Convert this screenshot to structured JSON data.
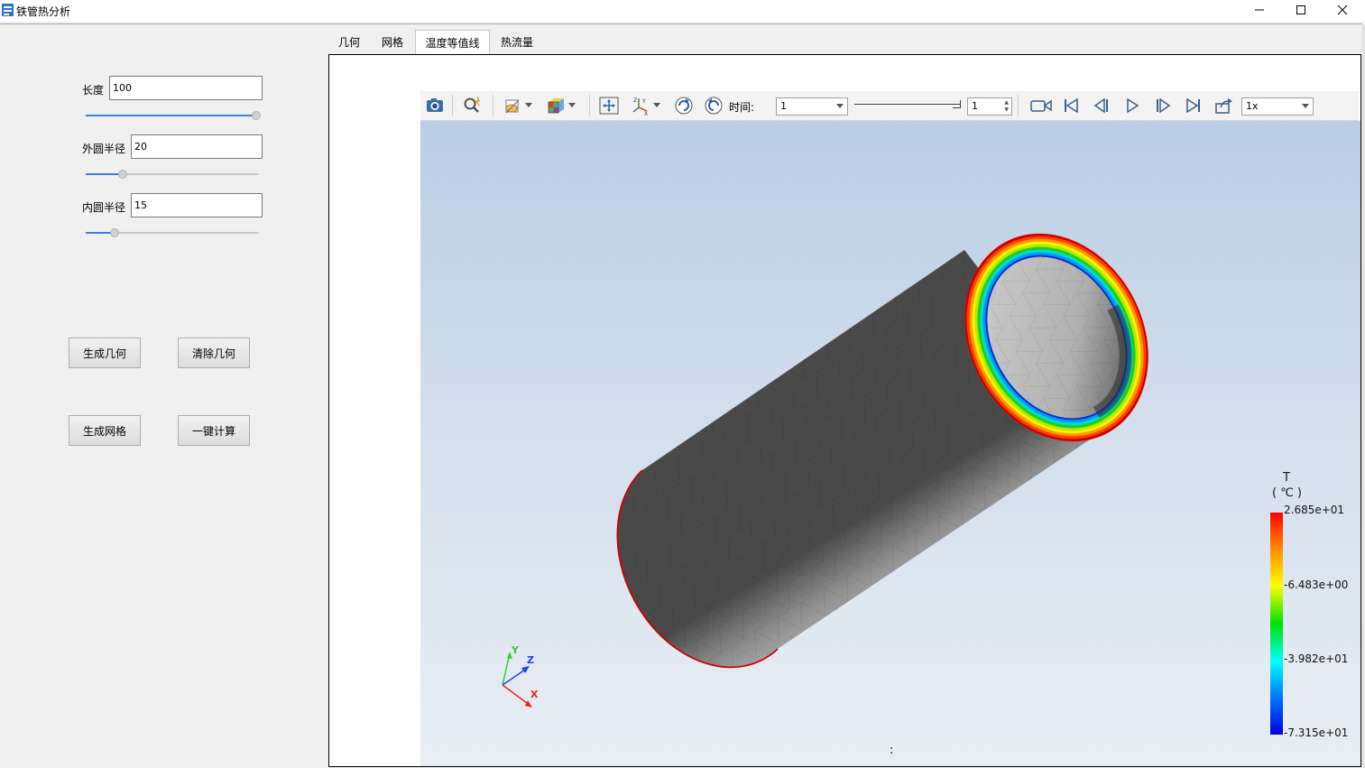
{
  "window": {
    "title": "铁管热分析",
    "buttons": {
      "minimize": "—",
      "maximize": "☐",
      "close": "✕"
    }
  },
  "params": {
    "length": {
      "label": "长度",
      "value": "100",
      "slider": 1.0
    },
    "outer_radius": {
      "label": "外圆半径",
      "value": "20",
      "slider": 0.2
    },
    "inner_radius": {
      "label": "内圆半径",
      "value": "15",
      "slider": 0.15
    }
  },
  "buttons": {
    "gen_geometry": "生成几何",
    "clear_geometry": "清除几何",
    "gen_mesh": "生成网格",
    "compute": "一键计算"
  },
  "tabs": [
    {
      "label": "几何",
      "active": false
    },
    {
      "label": "网格",
      "active": false
    },
    {
      "label": "温度等值线",
      "active": true
    },
    {
      "label": "热流量",
      "active": false
    }
  ],
  "toolbar": {
    "time_label": "时间:",
    "time_value": "1",
    "step_value": "1",
    "speed_value": "1x"
  },
  "icons": {
    "screenshot": "camera-icon",
    "zoom": "zoom-icon",
    "display": "display-mode-icon",
    "colormap": "colormap-cube-icon",
    "fit": "fit-view-icon",
    "axes": "axes-icon",
    "rotate_cw": "rotate-cw-icon",
    "rotate_ccw": "rotate-ccw-icon",
    "record": "record-video-icon",
    "first": "first-frame-icon",
    "prev": "prev-frame-icon",
    "play": "play-icon",
    "next": "next-frame-icon",
    "last": "last-frame-icon",
    "export": "export-icon"
  },
  "legend": {
    "title_line1": "T",
    "title_line2": "( ℃ )",
    "max": "2.685e+01",
    "mid_high": "-6.483e+00",
    "mid_low": "-3.982e+01",
    "min": "-7.315e+01",
    "colors": [
      "#ff0000",
      "#ffaa00",
      "#ffff00",
      "#00dd00",
      "#00dddd",
      "#0066ff",
      "#0000cc"
    ]
  },
  "triad": {
    "x": "X",
    "y": "Y",
    "z": "Z"
  },
  "status_mark": ":"
}
